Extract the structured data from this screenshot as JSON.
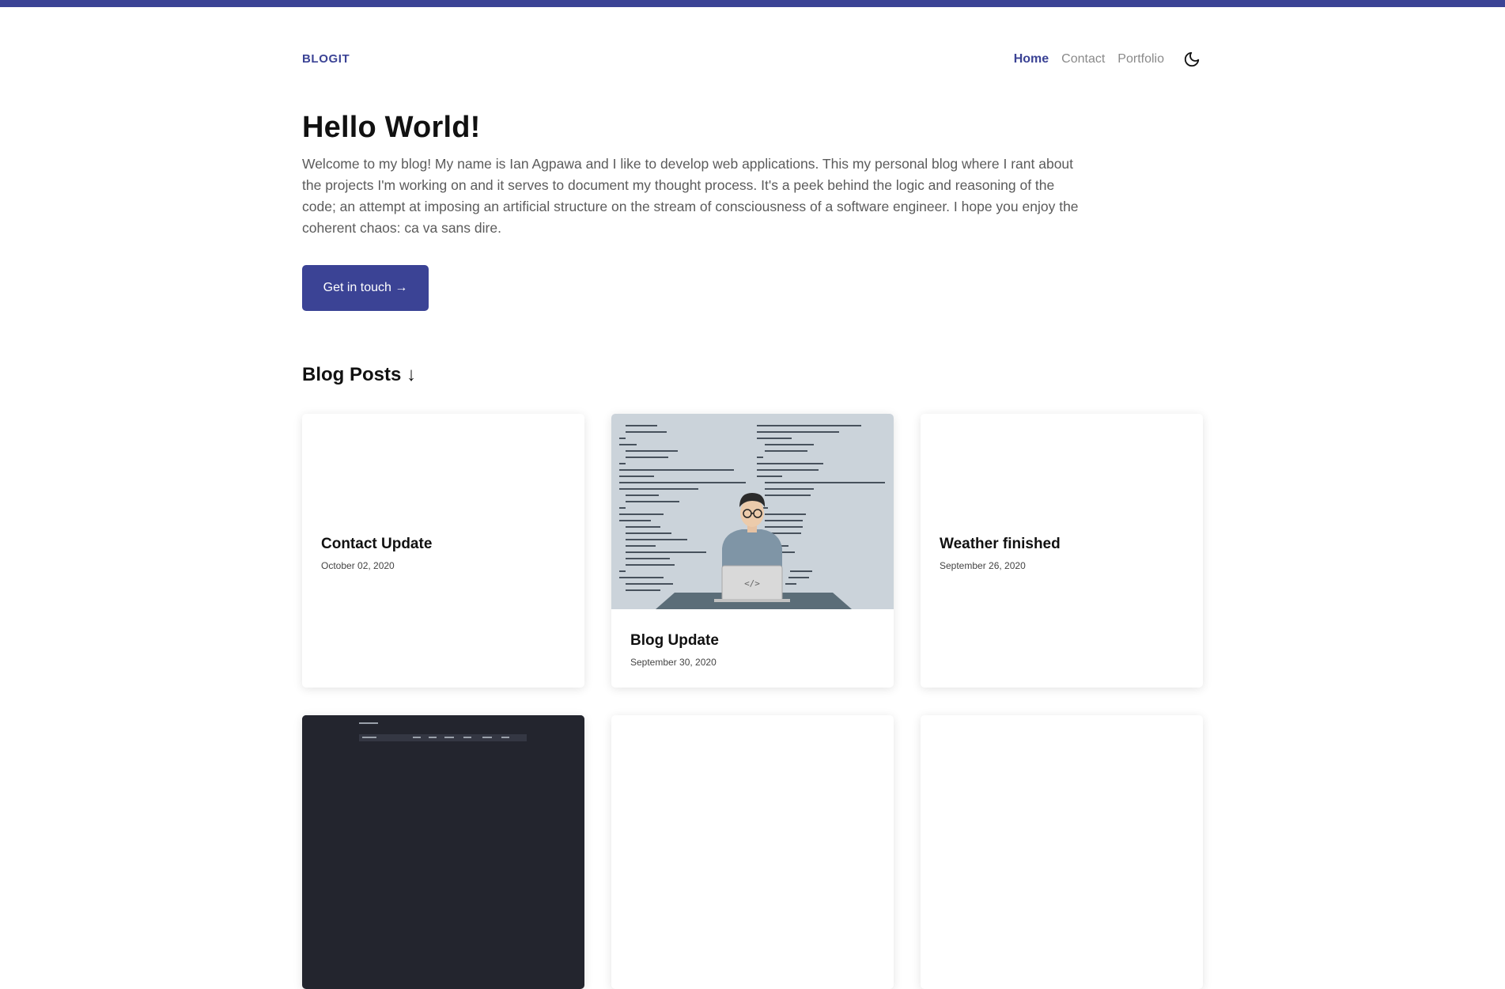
{
  "brand": "BLOGIT",
  "nav": {
    "home": "Home",
    "contact": "Contact",
    "portfolio": "Portfolio"
  },
  "hero": {
    "title": "Hello World!",
    "intro": "Welcome to my blog! My name is Ian Agpawa and I like to develop web applications. This my personal blog where I rant about the projects I'm working on and it serves to document my thought process. It's a peek behind the logic and reasoning of the code; an attempt at imposing an artificial structure on the stream of consciousness of a software engineer. I hope you enjoy the coherent chaos: ca va sans dire.",
    "cta_label": "Get in touch →"
  },
  "posts_heading": "Blog Posts ↓",
  "posts": [
    {
      "title": "Contact Update",
      "date": "October 02, 2020"
    },
    {
      "title": "Blog Update",
      "date": "September 30, 2020"
    },
    {
      "title": "Weather finished",
      "date": "September 26, 2020"
    }
  ],
  "colors": {
    "accent": "#3b4395",
    "text": "#111111",
    "muted": "#5b5b5b"
  },
  "icons": {
    "theme_toggle": "moon-icon"
  }
}
